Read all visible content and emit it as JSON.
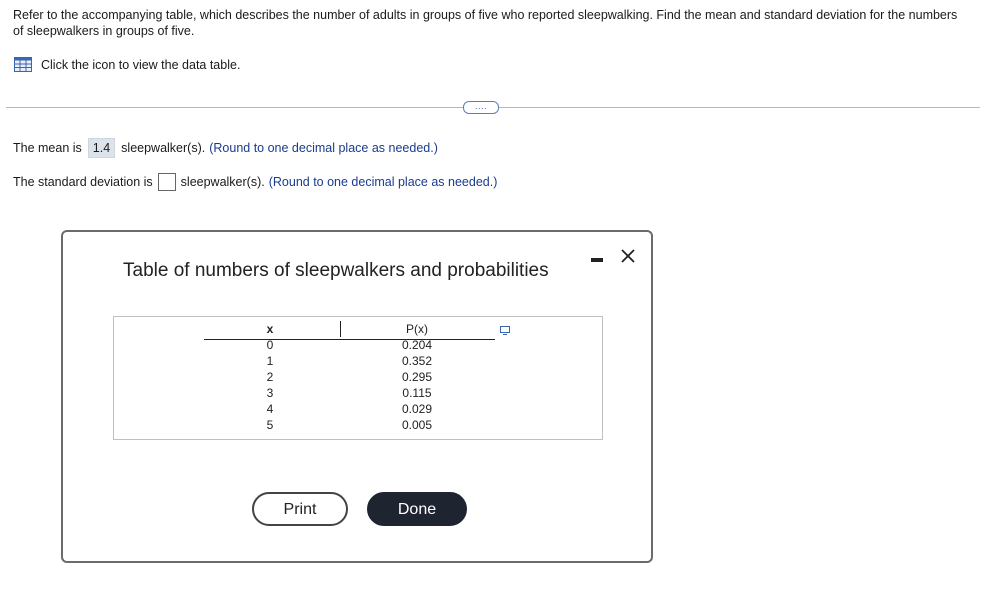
{
  "question": {
    "text": "Refer to the accompanying table, which describes the number of adults in groups of five who reported sleepwalking. Find the mean and standard deviation for the numbers of sleepwalkers in groups of five.",
    "data_link_label": "Click the icon to view the data table."
  },
  "more_button_label": "....",
  "answers": {
    "mean_prefix": "The mean is",
    "mean_value": "1.4",
    "mean_suffix": "sleepwalker(s).",
    "mean_hint": "(Round to one decimal place as needed.)",
    "sd_prefix": "The standard deviation is",
    "sd_value": "",
    "sd_suffix": "sleepwalker(s).",
    "sd_hint": "(Round to one decimal place as needed.)"
  },
  "modal": {
    "title": "Table of numbers of sleepwalkers and probabilities",
    "table": {
      "headers": [
        "x",
        "P(x)"
      ],
      "rows": [
        [
          "0",
          "0.204"
        ],
        [
          "1",
          "0.352"
        ],
        [
          "2",
          "0.295"
        ],
        [
          "3",
          "0.115"
        ],
        [
          "4",
          "0.029"
        ],
        [
          "5",
          "0.005"
        ]
      ]
    },
    "print_label": "Print",
    "done_label": "Done"
  },
  "colors": {
    "hint_text": "#1a3b8f",
    "done_button_bg": "#1e2530",
    "filled_answer_bg": "#dde3ea"
  }
}
